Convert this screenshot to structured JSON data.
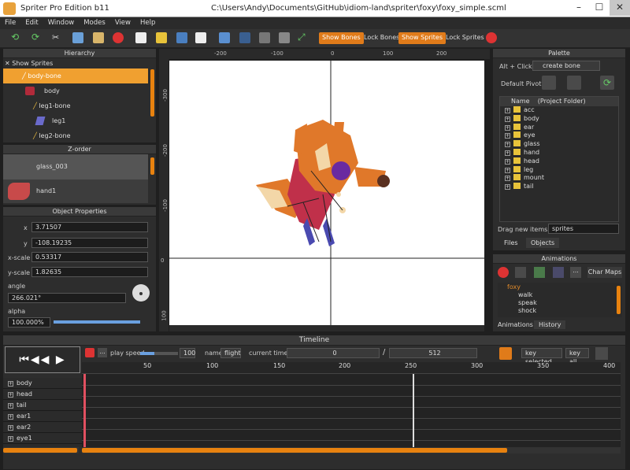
{
  "window": {
    "title": "Spriter Pro Edition b11",
    "path": "C:\\Users\\Andy\\Documents\\GitHub\\idiom-land\\spriter\\foxy\\foxy_simple.scml",
    "min": "–",
    "max": "☐",
    "close": "✕"
  },
  "menu": [
    "File",
    "Edit",
    "Window",
    "Modes",
    "View",
    "Help"
  ],
  "toolbar": {
    "show_bones": "Show Bones",
    "lock_bones": "Lock Bones",
    "show_sprites": "Show Sprites",
    "lock_sprites": "Lock Sprites"
  },
  "hierarchy": {
    "title": "Hierarchy",
    "show_sprites": "Show Sprites",
    "items": [
      "body-bone",
      "body",
      "leg1-bone",
      "leg1",
      "leg2-bone"
    ]
  },
  "zorder": {
    "title": "Z-order",
    "items": [
      "glass_003",
      "hand1"
    ]
  },
  "props": {
    "title": "Object Properties",
    "x_label": "x",
    "x": "3.71507",
    "y_label": "y",
    "y": "-108.19235",
    "xscale_label": "x-scale",
    "xscale": "0.53317",
    "yscale_label": "y-scale",
    "yscale": "1.82635",
    "angle_label": "angle",
    "angle": "266.021°",
    "alpha_label": "alpha",
    "alpha": "100.000%",
    "alpha_fraction": 1.0
  },
  "canvas": {
    "top_ticks": [
      "-200",
      "-100",
      "0",
      "100",
      "200"
    ],
    "left_ticks": [
      "-300",
      "-200",
      "-100",
      "0",
      "100"
    ]
  },
  "palette": {
    "title": "Palette",
    "alt_click": "Alt + Click:",
    "create_bone": "create bone",
    "default_pivot": "Default Pivot:",
    "col_name": "Name",
    "col_folder": "(Project Folder)",
    "folders": [
      "acc",
      "body",
      "ear",
      "eye",
      "glass",
      "hand",
      "head",
      "leg",
      "mount",
      "tail"
    ],
    "drag_label": "Drag new items as",
    "drag_value": "sprites",
    "tabs": [
      "Files",
      "Objects"
    ]
  },
  "animations": {
    "title": "Animations",
    "char_maps": "Char Maps",
    "entity": "foxy",
    "items": [
      "walk",
      "speak",
      "shock"
    ],
    "tabs": [
      "Animations",
      "History"
    ]
  },
  "timeline": {
    "title": "Timeline",
    "play_speed_label": "play speed",
    "play_speed": "100",
    "name_label": "name",
    "name": "flight",
    "current_time_label": "current time:",
    "current_time": "0",
    "slash": "/",
    "length": "512",
    "key_selected": "key selected",
    "key_all": "key all",
    "ticks": [
      "50",
      "100",
      "150",
      "200",
      "250",
      "300",
      "350",
      "400"
    ],
    "tracks": [
      "body",
      "head",
      "tail",
      "ear1",
      "ear2",
      "eye1"
    ]
  },
  "colors": {
    "accent": "#e07b1a",
    "panel": "#2d2d2d",
    "selection": "#e8a23c"
  }
}
